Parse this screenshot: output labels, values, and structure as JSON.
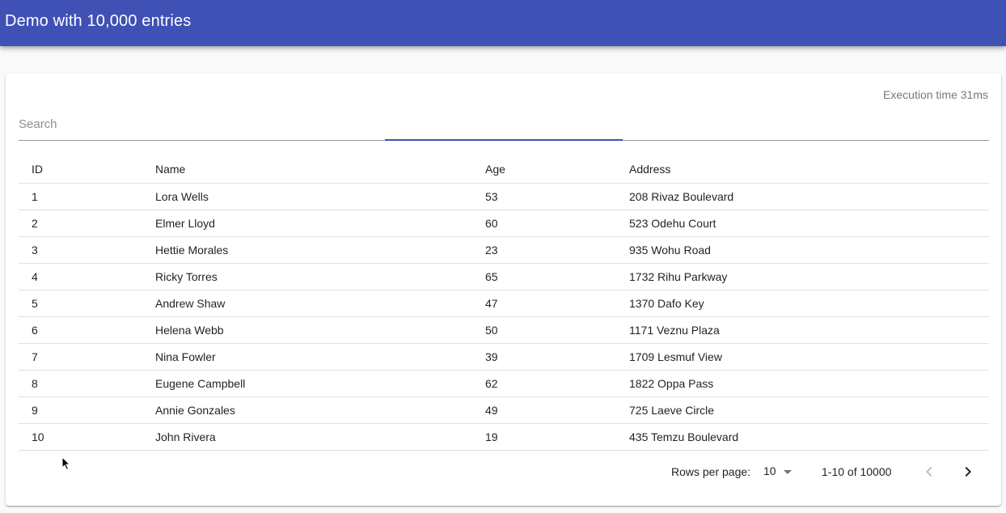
{
  "app": {
    "title": "Demo with 10,000 entries"
  },
  "stats": {
    "execution_time": "Execution time 31ms"
  },
  "search": {
    "placeholder": "Search",
    "value": ""
  },
  "table": {
    "headers": {
      "id": "ID",
      "name": "Name",
      "age": "Age",
      "address": "Address"
    },
    "rows": [
      {
        "id": "1",
        "name": "Lora Wells",
        "age": "53",
        "address": "208 Rivaz Boulevard"
      },
      {
        "id": "2",
        "name": "Elmer Lloyd",
        "age": "60",
        "address": "523 Odehu Court"
      },
      {
        "id": "3",
        "name": "Hettie Morales",
        "age": "23",
        "address": "935 Wohu Road"
      },
      {
        "id": "4",
        "name": "Ricky Torres",
        "age": "65",
        "address": "1732 Rihu Parkway"
      },
      {
        "id": "5",
        "name": "Andrew Shaw",
        "age": "47",
        "address": "1370 Dafo Key"
      },
      {
        "id": "6",
        "name": "Helena Webb",
        "age": "50",
        "address": "1171 Veznu Plaza"
      },
      {
        "id": "7",
        "name": "Nina Fowler",
        "age": "39",
        "address": "1709 Lesmuf View"
      },
      {
        "id": "8",
        "name": "Eugene Campbell",
        "age": "62",
        "address": "1822 Oppa Pass"
      },
      {
        "id": "9",
        "name": "Annie Gonzales",
        "age": "49",
        "address": "725 Laeve Circle"
      },
      {
        "id": "10",
        "name": "John Rivera",
        "age": "19",
        "address": "435 Temzu Boulevard"
      }
    ]
  },
  "pagination": {
    "rows_per_page_label": "Rows per page:",
    "rows_per_page_value": "10",
    "range": "1-10 of 10000",
    "prev_icon": "chevron-left-icon",
    "next_icon": "chevron-right-icon"
  },
  "colors": {
    "primary": "#3f51b5",
    "background": "#fafafa"
  }
}
